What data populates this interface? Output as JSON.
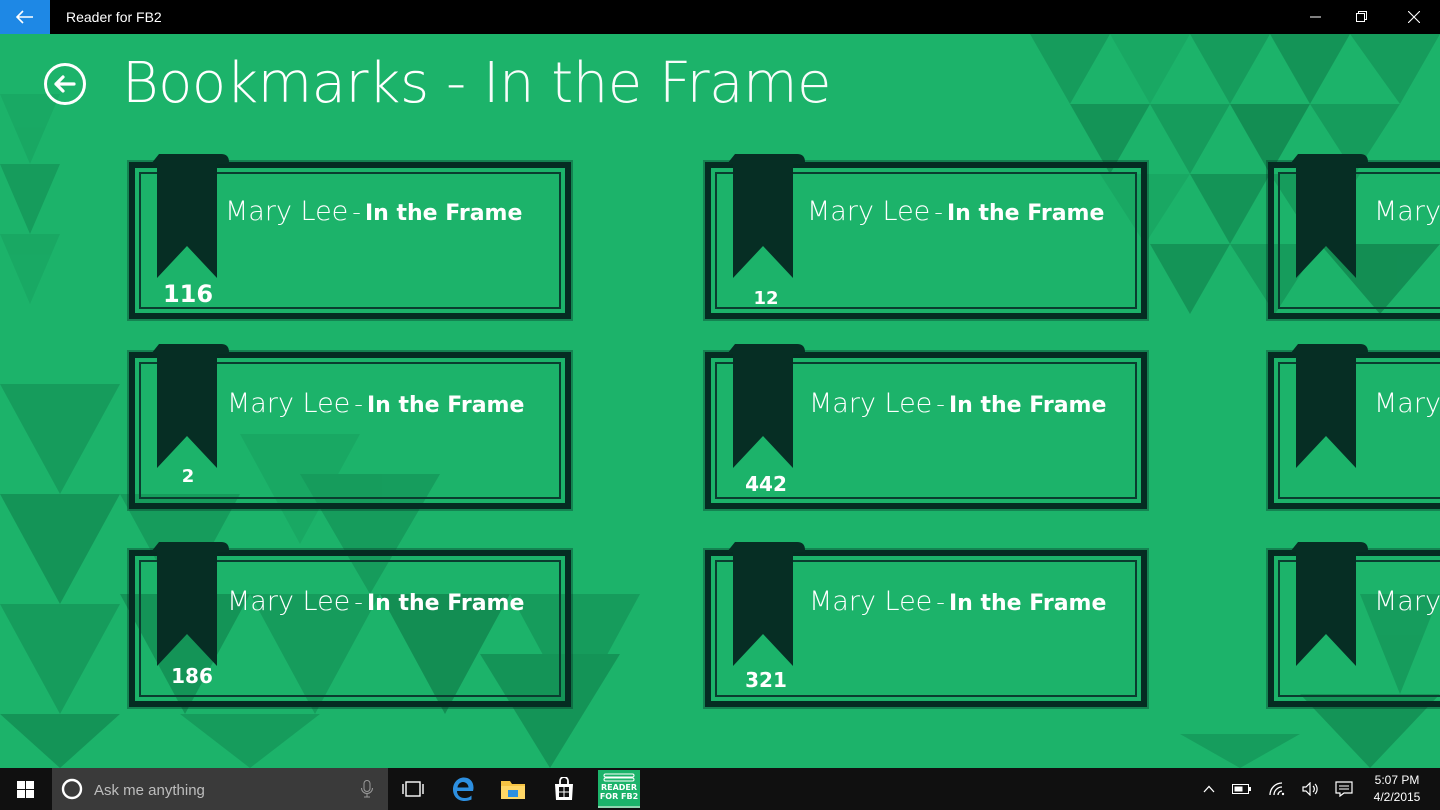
{
  "window": {
    "title": "Reader for FB2"
  },
  "page": {
    "title": "Bookmarks",
    "separator": "-",
    "book": "In the Frame"
  },
  "bookmarks": [
    {
      "author": "Mary Lee",
      "separator": "-",
      "book": "In the Frame",
      "page": "116"
    },
    {
      "author": "Mary Lee",
      "separator": "-",
      "book": "In the Frame",
      "page": "2"
    },
    {
      "author": "Mary Lee",
      "separator": "-",
      "book": "In the Frame",
      "page": "186"
    },
    {
      "author": "Mary Lee",
      "separator": "-",
      "book": "In the Frame",
      "page": "12"
    },
    {
      "author": "Mary Lee",
      "separator": "-",
      "book": "In the Frame",
      "page": "442"
    },
    {
      "author": "Mary Lee",
      "separator": "-",
      "book": "In the Frame",
      "page": "321"
    },
    {
      "author": "Mary",
      "separator": "",
      "book": "",
      "page": ""
    },
    {
      "author": "Mary",
      "separator": "",
      "book": "",
      "page": ""
    },
    {
      "author": "Mary",
      "separator": "",
      "book": "",
      "page": ""
    }
  ],
  "taskbar": {
    "search_placeholder": "Ask me anything",
    "pinned": [
      "task-view-icon",
      "edge-icon",
      "file-explorer-icon",
      "store-icon",
      "reader-for-fb2-icon"
    ],
    "reader_tile_label_1": "READER",
    "reader_tile_label_2": "FOR FB2",
    "time": "5:07 PM",
    "date": "4/2/2015"
  },
  "colors": {
    "accent_green": "#1cb36a",
    "dark_green": "#052c22",
    "titlebar_back_blue": "#1e88e5"
  }
}
